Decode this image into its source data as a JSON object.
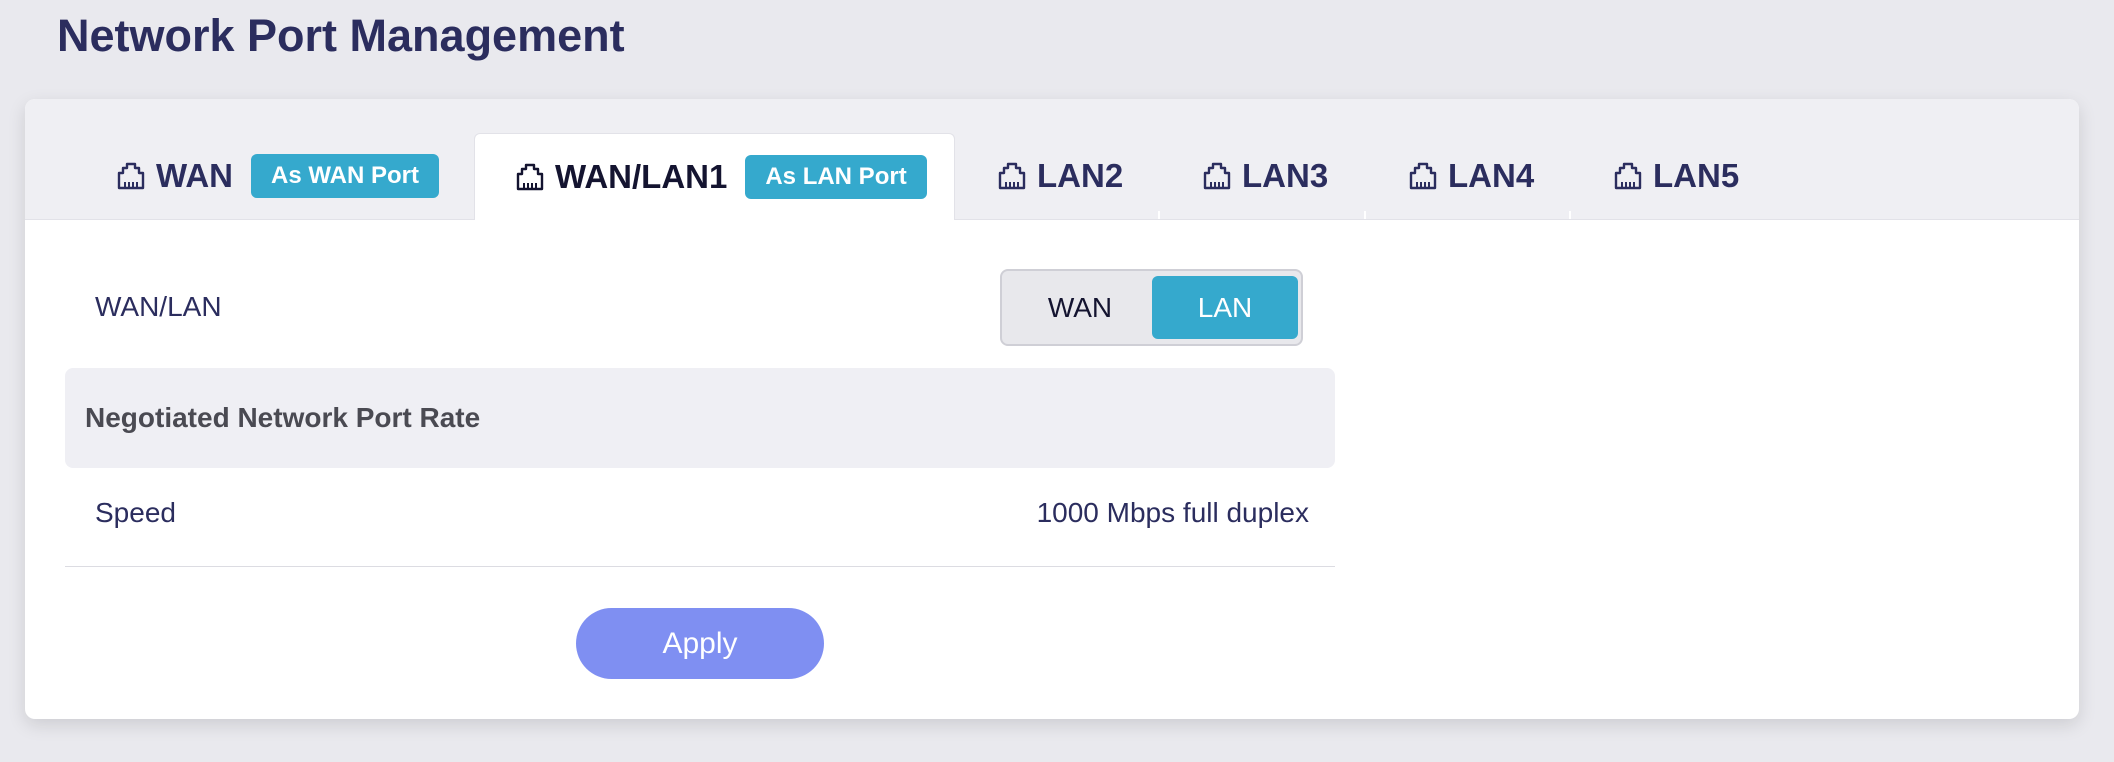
{
  "page": {
    "title": "Network Port Management"
  },
  "tabs": [
    {
      "label": "WAN",
      "badge": "As WAN Port",
      "icon": "ethernet-port-icon",
      "active": false
    },
    {
      "label": "WAN/LAN1",
      "badge": "As LAN Port",
      "icon": "ethernet-port-icon",
      "active": true
    },
    {
      "label": "LAN2",
      "icon": "ethernet-port-icon",
      "active": false
    },
    {
      "label": "LAN3",
      "icon": "ethernet-port-icon",
      "active": false
    },
    {
      "label": "LAN4",
      "icon": "ethernet-port-icon",
      "active": false
    },
    {
      "label": "LAN5",
      "icon": "ethernet-port-icon",
      "active": false
    }
  ],
  "mode": {
    "label": "WAN/LAN",
    "options": [
      "WAN",
      "LAN"
    ],
    "selected": "LAN"
  },
  "rate_section": {
    "title": "Negotiated Network Port Rate",
    "speed_label": "Speed",
    "speed_value": "1000 Mbps full duplex"
  },
  "actions": {
    "apply_label": "Apply"
  },
  "colors": {
    "accent": "#35a9cd",
    "apply_button": "#7f8ff2",
    "title_text": "#2b2d5e",
    "page_bg": "#e9e9ee"
  }
}
